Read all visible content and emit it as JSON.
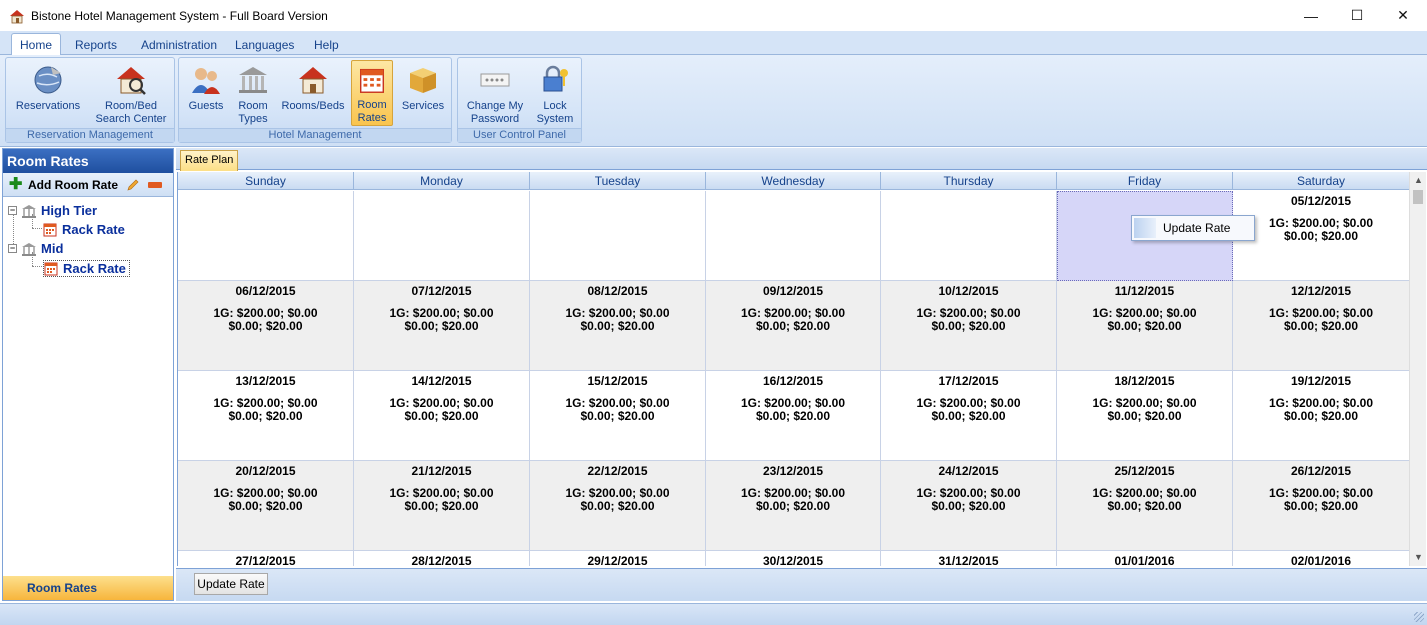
{
  "window": {
    "title": "Bistone Hotel Management System - Full Board Version",
    "minimize": "—",
    "maximize": "☐",
    "close": "✕"
  },
  "ribbon": {
    "tabs": [
      "Home",
      "Reports",
      "Administration",
      "Languages",
      "Help"
    ],
    "groups": [
      {
        "label": "Reservation Management",
        "buttons": [
          "Reservations",
          "Room/Bed\nSearch Center"
        ]
      },
      {
        "label": "Hotel Management",
        "buttons": [
          "Guests",
          "Room\nTypes",
          "Rooms/Beds",
          "Room\nRates",
          "Services"
        ]
      },
      {
        "label": "User Control Panel",
        "buttons": [
          "Change My\nPassword",
          "Lock\nSystem"
        ]
      }
    ]
  },
  "left_panel": {
    "header": "Room Rates",
    "add_label": "Add Room Rate",
    "tree": [
      {
        "label": "High Tier",
        "children": [
          "Rack Rate"
        ]
      },
      {
        "label": "Mid",
        "children": [
          "Rack Rate"
        ]
      }
    ],
    "footer": "Room Rates"
  },
  "main": {
    "tab": "Rate Plan",
    "days": [
      "Sunday",
      "Monday",
      "Tuesday",
      "Wednesday",
      "Thursday",
      "Friday",
      "Saturday"
    ],
    "rate_line1": "1G: $200.00; $0.00",
    "rate_line2": "$0.00; $20.00",
    "weeks": [
      [
        "",
        "",
        "",
        "",
        "",
        "",
        "05/12/2015"
      ],
      [
        "06/12/2015",
        "07/12/2015",
        "08/12/2015",
        "09/12/2015",
        "10/12/2015",
        "11/12/2015",
        "12/12/2015"
      ],
      [
        "13/12/2015",
        "14/12/2015",
        "15/12/2015",
        "16/12/2015",
        "17/12/2015",
        "18/12/2015",
        "19/12/2015"
      ],
      [
        "20/12/2015",
        "21/12/2015",
        "22/12/2015",
        "23/12/2015",
        "24/12/2015",
        "25/12/2015",
        "26/12/2015"
      ],
      [
        "27/12/2015",
        "28/12/2015",
        "29/12/2015",
        "30/12/2015",
        "31/12/2015",
        "01/01/2016",
        "02/01/2016"
      ]
    ],
    "context_menu_item": "Update Rate",
    "update_button": "Update Rate"
  }
}
